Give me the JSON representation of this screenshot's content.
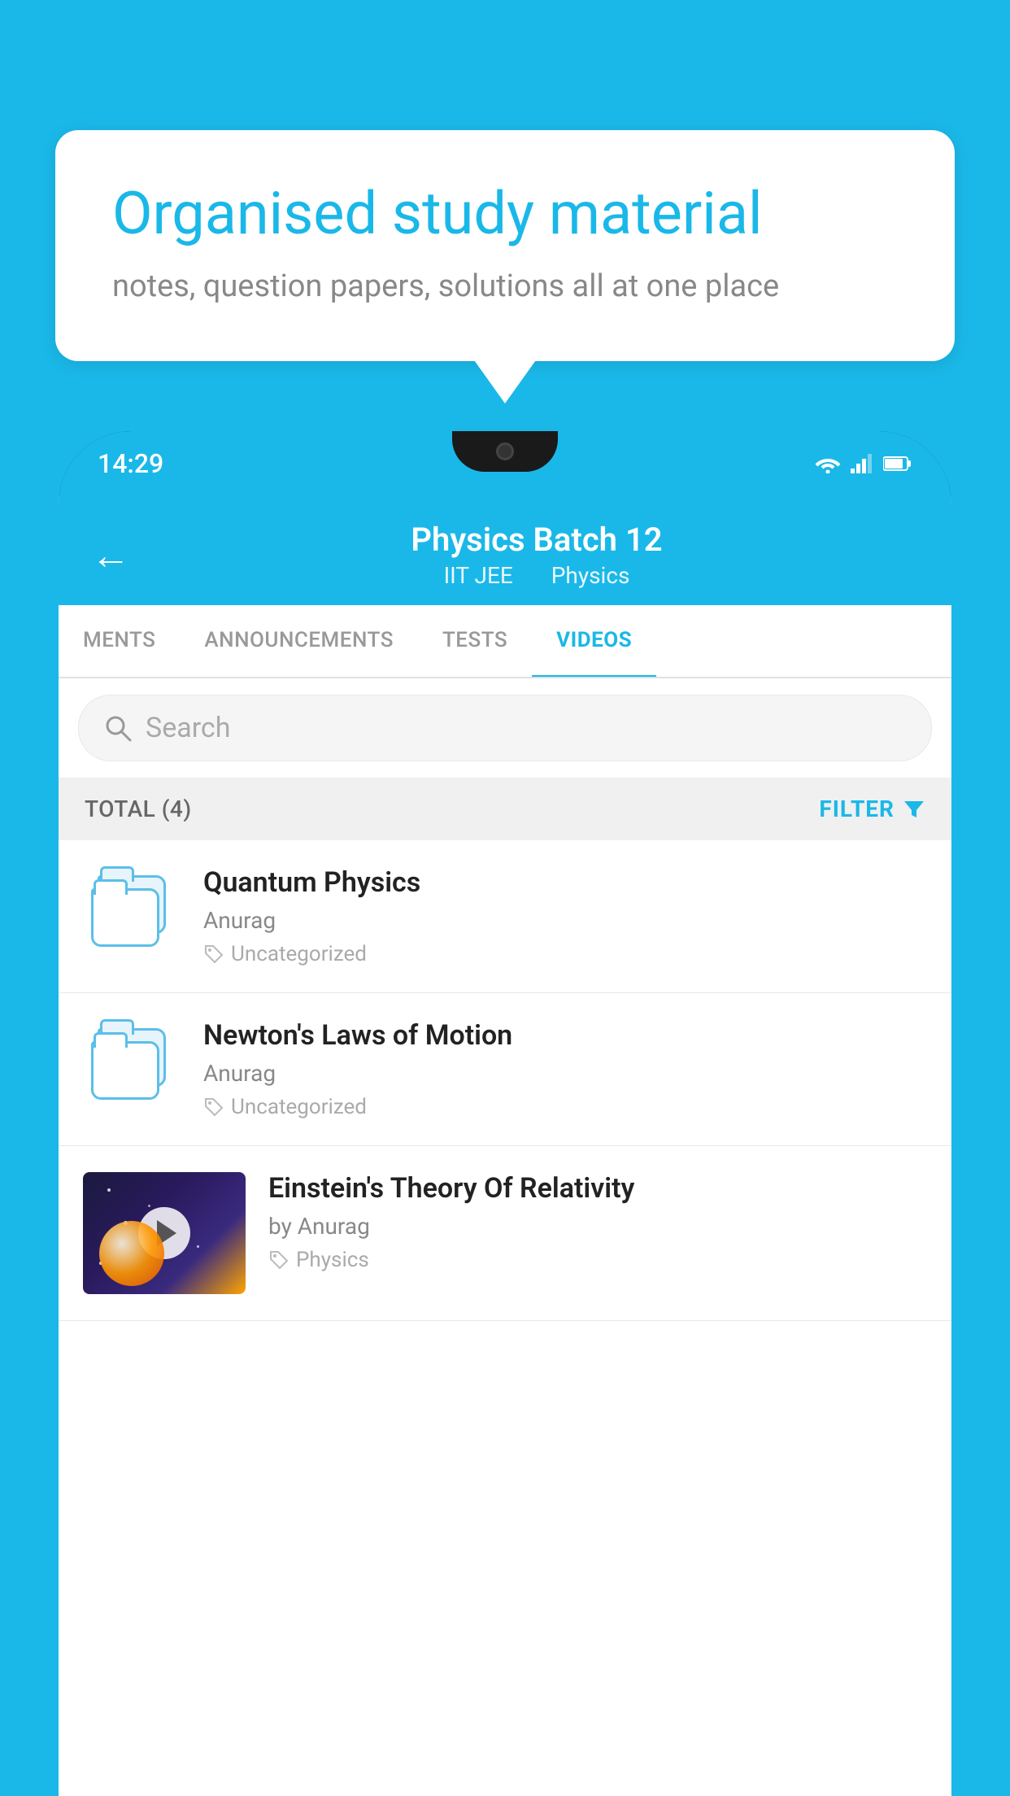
{
  "background_color": "#1ab8e8",
  "bubble": {
    "title": "Organised study material",
    "subtitle": "notes, question papers, solutions all at one place"
  },
  "phone": {
    "status_bar": {
      "time": "14:29",
      "icons": [
        "wifi",
        "signal",
        "battery"
      ]
    },
    "header": {
      "back_label": "←",
      "title": "Physics Batch 12",
      "subtitle_part1": "IIT JEE",
      "subtitle_part2": "Physics"
    },
    "tabs": [
      {
        "label": "MENTS",
        "active": false
      },
      {
        "label": "ANNOUNCEMENTS",
        "active": false
      },
      {
        "label": "TESTS",
        "active": false
      },
      {
        "label": "VIDEOS",
        "active": true
      }
    ],
    "search": {
      "placeholder": "Search"
    },
    "filter": {
      "total_label": "TOTAL (4)",
      "filter_label": "FILTER"
    },
    "videos": [
      {
        "id": 1,
        "title": "Quantum Physics",
        "author": "Anurag",
        "tag": "Uncategorized",
        "has_thumbnail": false
      },
      {
        "id": 2,
        "title": "Newton's Laws of Motion",
        "author": "Anurag",
        "tag": "Uncategorized",
        "has_thumbnail": false
      },
      {
        "id": 3,
        "title": "Einstein's Theory Of Relativity",
        "author": "by Anurag",
        "tag": "Physics",
        "has_thumbnail": true
      }
    ]
  }
}
